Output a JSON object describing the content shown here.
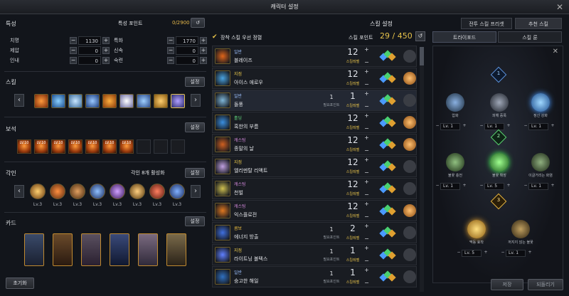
{
  "window": {
    "title": "캐릭터 설정"
  },
  "traits": {
    "title": "특성",
    "points_label": "특성 포인트",
    "points_value": "0/2900",
    "stats": [
      {
        "name": "치명",
        "value": "1130"
      },
      {
        "name": "특화",
        "value": "1770"
      },
      {
        "name": "제압",
        "value": "0"
      },
      {
        "name": "신속",
        "value": "0"
      },
      {
        "name": "인내",
        "value": "0"
      },
      {
        "name": "숙련",
        "value": "0"
      }
    ]
  },
  "skills": {
    "title": "스킬",
    "settings_label": "설정"
  },
  "gems": {
    "title": "보석",
    "settings_label": "설정",
    "labels": [
      "LV.10",
      "LV.10",
      "LV.10",
      "LV.10",
      "LV.10",
      "LV.10",
      "LV.10"
    ]
  },
  "engravings": {
    "title": "각인",
    "summary": "각인 8개 활성화",
    "settings_label": "설정",
    "levels": [
      "Lv.3",
      "Lv.3",
      "Lv.3",
      "Lv.3",
      "Lv.3",
      "Lv.3",
      "Lv.3",
      "Lv.3"
    ]
  },
  "cards": {
    "title": "카드",
    "settings_label": "설정"
  },
  "bottom": {
    "reset_label": "초기화",
    "save_label": "저장",
    "back_label": "되돌리기"
  },
  "skill_settings": {
    "title": "스킬 설정",
    "checkbox_label": "장착 스킬 우선 정렬",
    "points_label": "스킬 포인트",
    "points_value": "29 / 450",
    "point_unit": "스킬레벨",
    "point_unit2": "필요포인트",
    "rows": [
      {
        "type": "일반",
        "type_color": "#9ec2ff",
        "name": "블레이즈",
        "points": "",
        "level": "12",
        "icon": "#e0651a"
      },
      {
        "type": "지점",
        "type_color": "#e9c84b",
        "name": "아이스 애로우",
        "points": "",
        "level": "12",
        "icon": "#4aa3e0"
      },
      {
        "type": "일반",
        "type_color": "#9ec2ff",
        "name": "돌풍",
        "points": "1",
        "level": "1",
        "icon": "#7fb6d8"
      },
      {
        "type": "홀딩",
        "type_color": "#5fd07a",
        "name": "혹한의 부름",
        "points": "",
        "level": "12",
        "icon": "#3b8fe0"
      },
      {
        "type": "캐스팅",
        "type_color": "#d88be0",
        "name": "종말의 날",
        "points": "",
        "level": "12",
        "icon": "#d06020"
      },
      {
        "type": "지점",
        "type_color": "#e9c84b",
        "name": "엘리멘탈 리액트",
        "points": "",
        "level": "12",
        "icon": "#c0a0e0"
      },
      {
        "type": "캐스팅",
        "type_color": "#d88be0",
        "name": "천벌",
        "points": "",
        "level": "12",
        "icon": "#d0c050"
      },
      {
        "type": "캐스팅",
        "type_color": "#d88be0",
        "name": "익스플로전",
        "points": "",
        "level": "12",
        "icon": "#e07820"
      },
      {
        "type": "콤보",
        "type_color": "#f0c040",
        "name": "에너지 방출",
        "points": "1",
        "level": "2",
        "icon": "#4070e0"
      },
      {
        "type": "지점",
        "type_color": "#e9c84b",
        "name": "라이트닝 볼텍스",
        "points": "1",
        "level": "1",
        "icon": "#6080ff"
      },
      {
        "type": "일반",
        "type_color": "#9ec2ff",
        "name": "숭고한 해일",
        "points": "1",
        "level": "1",
        "icon": "#3070c0"
      }
    ]
  },
  "presets": {
    "combat_preset_label": "전투 스킬 프리셋",
    "recommended_label": "추천 스킬"
  },
  "tripod_panel": {
    "tab_tripod": "트라이포드",
    "tab_rune": "스킬 룬",
    "tiers": [
      "1",
      "2",
      "3"
    ],
    "tier1": [
      {
        "name": "압화",
        "lv": "Lv. 1"
      },
      {
        "name": "피해 증폭",
        "lv": "Lv. 1"
      },
      {
        "name": "정신 강화",
        "lv": "Lv. 1"
      }
    ],
    "tier2": [
      {
        "name": "불꽃 충전",
        "lv": "Lv. 1"
      },
      {
        "name": "불꽃 확장",
        "lv": "Lv. 5"
      },
      {
        "name": "이글거리는 화염",
        "lv": "Lv. 1"
      }
    ],
    "tier3": [
      {
        "name": "맥동 효착",
        "lv": "Lv. 5"
      },
      {
        "name": "꺼지지 않는 불꽃",
        "lv": "Lv. 1"
      }
    ]
  }
}
